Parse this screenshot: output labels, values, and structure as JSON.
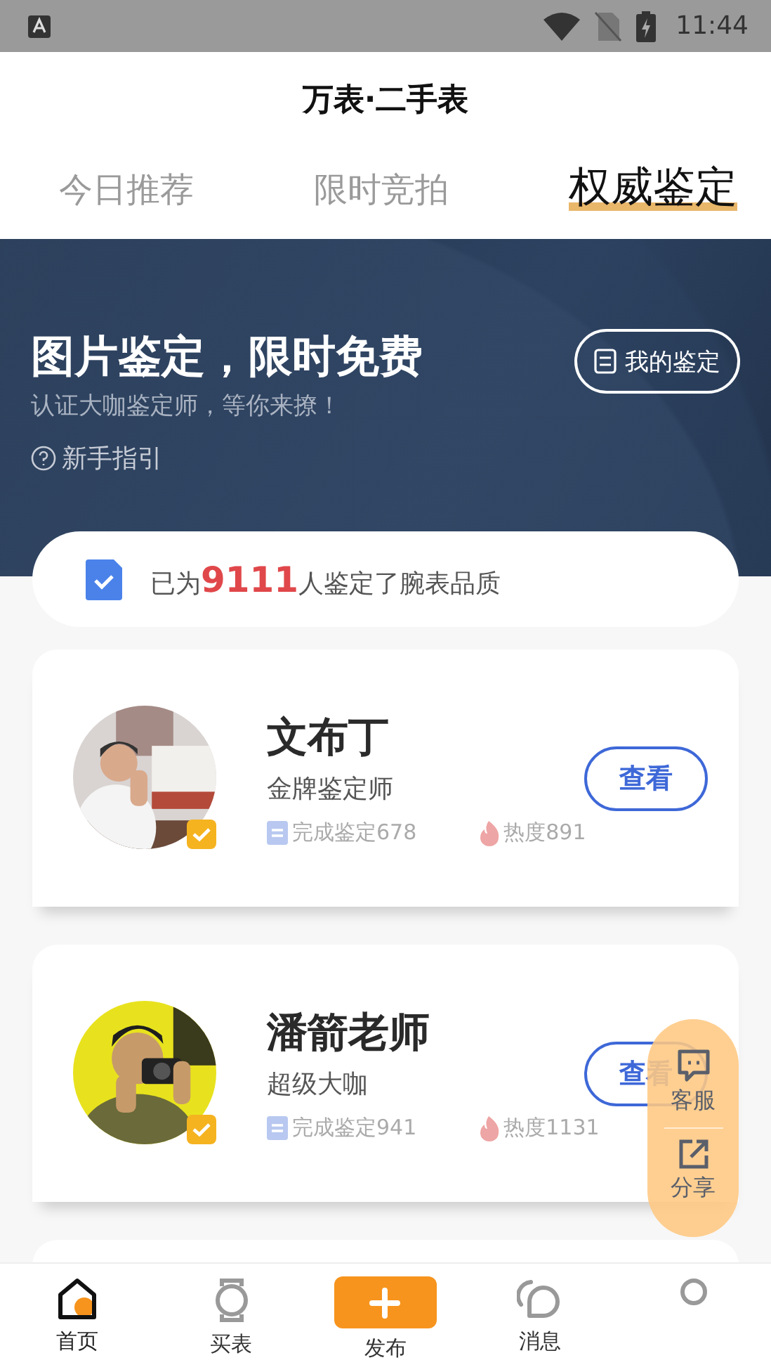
{
  "status_bar": {
    "time": "11:44"
  },
  "header": {
    "title": "万表·二手表"
  },
  "tabs": [
    {
      "label": "今日推荐",
      "selected": false
    },
    {
      "label": "限时竞拍",
      "selected": false
    },
    {
      "label": "权威鉴定",
      "selected": true
    }
  ],
  "banner": {
    "headline": "图片鉴定，限时免费",
    "subline": "认证大咖鉴定师，等你来撩！",
    "guide_link": "新手指引",
    "my_button": "我的鉴定"
  },
  "stats": {
    "prefix": "已为",
    "count": "9111",
    "suffix": "人鉴定了腕表品质"
  },
  "experts": [
    {
      "name": "文布丁",
      "title": "金牌鉴定师",
      "completed": "完成鉴定678",
      "heat": "热度891",
      "button": "查看",
      "verified": true
    },
    {
      "name": "潘箭老师",
      "title": "超级大咖",
      "completed": "完成鉴定941",
      "heat": "热度1131",
      "button": "查看",
      "verified": true
    }
  ],
  "floating_actions": [
    {
      "label": "客服",
      "kind": "chat"
    },
    {
      "label": "分享",
      "kind": "share"
    }
  ],
  "bottom_nav": [
    {
      "label": "首页",
      "kind": "home",
      "selected": true
    },
    {
      "label": "买表",
      "kind": "watch",
      "selected": false
    },
    {
      "label": "发布",
      "kind": "publish",
      "selected": false
    },
    {
      "label": "消息",
      "kind": "message",
      "selected": false
    },
    {
      "kind": "profile",
      "selected": false
    }
  ]
}
